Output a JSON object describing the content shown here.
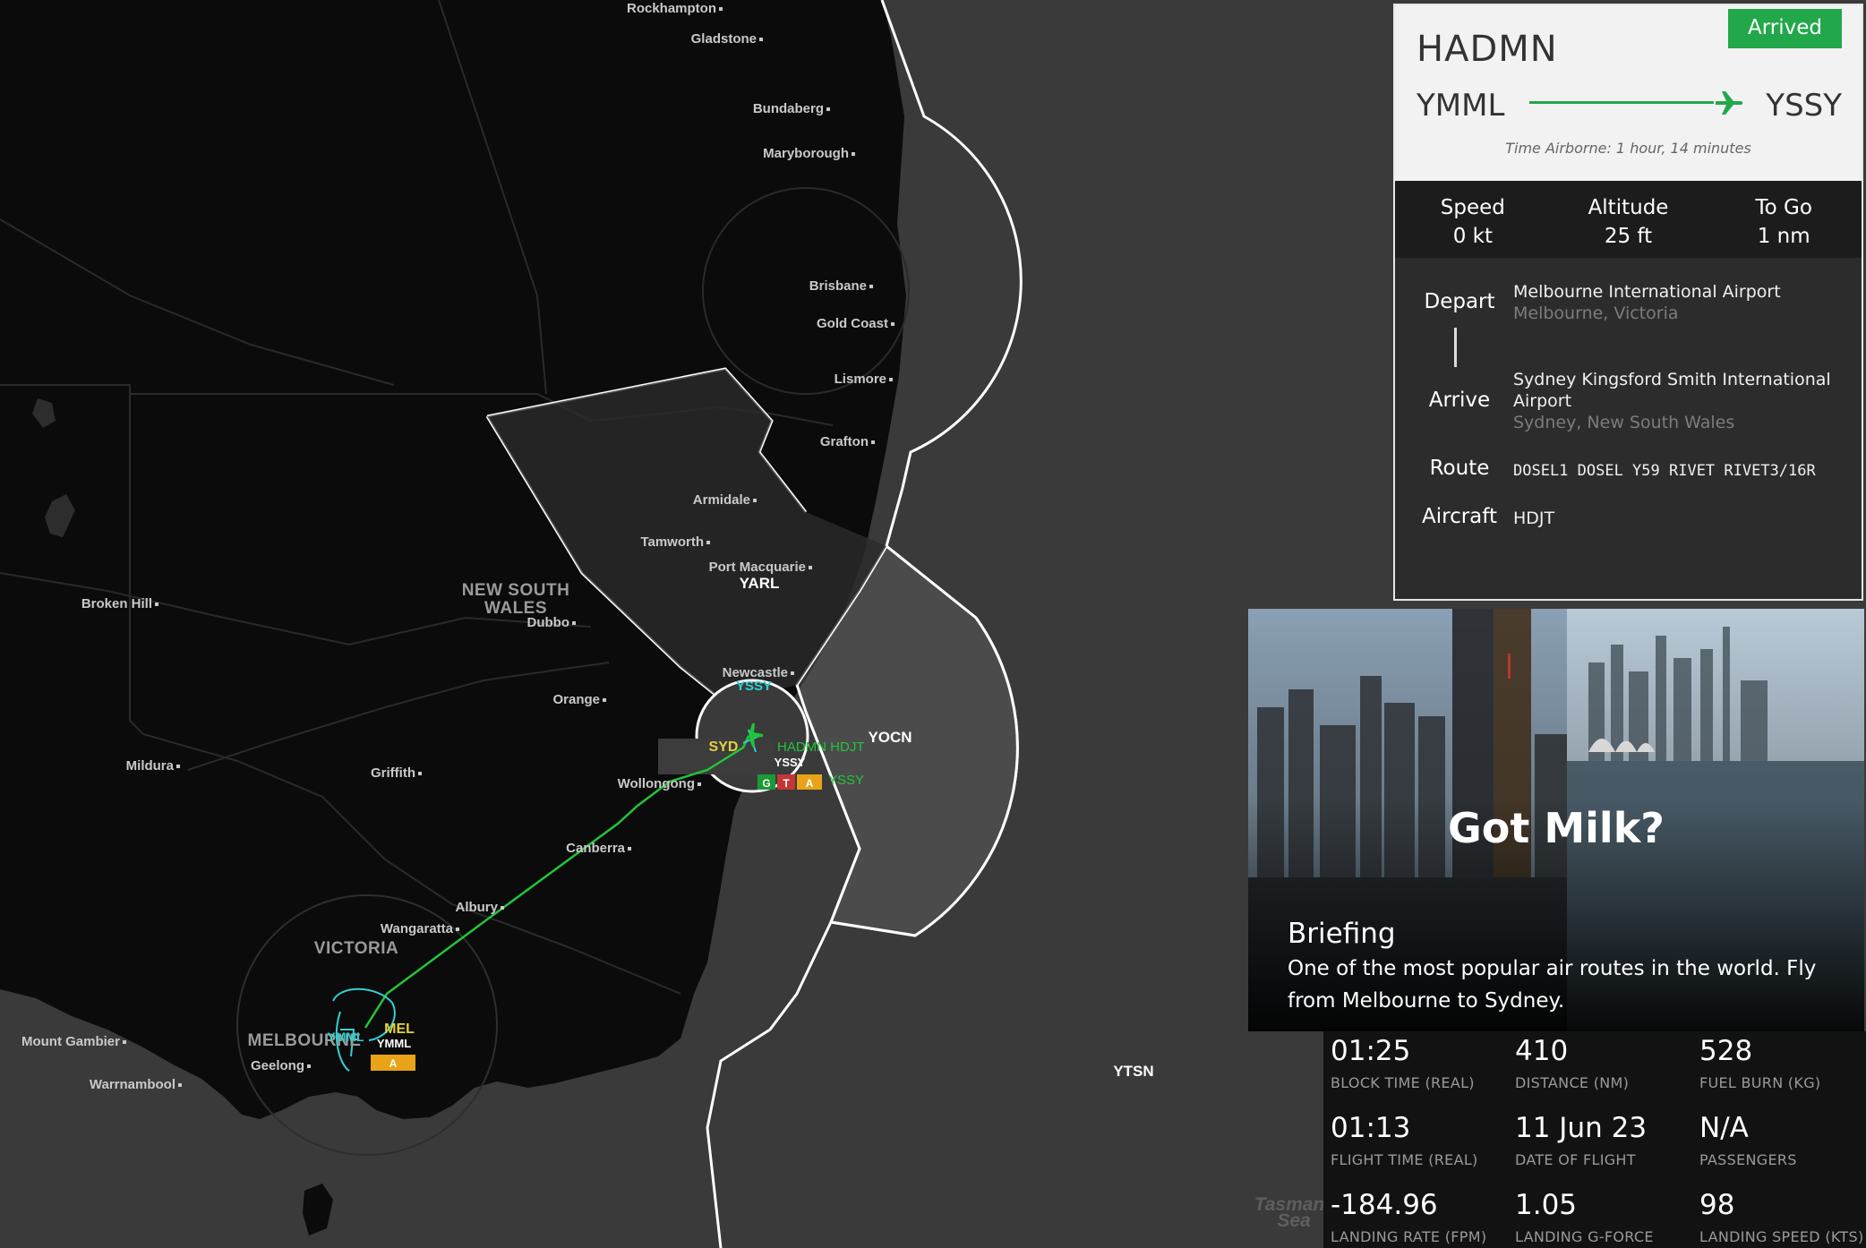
{
  "map": {
    "cities": [
      {
        "name": "Rockhampton"
      },
      {
        "name": "Gladstone"
      },
      {
        "name": "Bundaberg"
      },
      {
        "name": "Maryborough"
      },
      {
        "name": "Brisbane"
      },
      {
        "name": "Gold Coast"
      },
      {
        "name": "Lismore"
      },
      {
        "name": "Grafton"
      },
      {
        "name": "Armidale"
      },
      {
        "name": "Tamworth"
      },
      {
        "name": "Port Macquarie"
      },
      {
        "name": "Broken Hill"
      },
      {
        "name": "Dubbo"
      },
      {
        "name": "Newcastle"
      },
      {
        "name": "Orange"
      },
      {
        "name": "Mildura"
      },
      {
        "name": "Griffith"
      },
      {
        "name": "Wollongong"
      },
      {
        "name": "Canberra"
      },
      {
        "name": "Albury"
      },
      {
        "name": "Wangaratta"
      },
      {
        "name": "Mount Gambier"
      },
      {
        "name": "Geelong"
      },
      {
        "name": "Warrnambool"
      }
    ],
    "regions": [
      "NEW SOUTH",
      "WALES",
      "VICTORIA",
      "MELBOURNE"
    ],
    "sectors": [
      "YARL",
      "YOCN",
      "YTSN"
    ],
    "ocean": [
      "Tasman",
      "Sea"
    ],
    "airports": {
      "origin_code": "YMML",
      "origin_short": "MEL",
      "origin_alt": "YMML",
      "dest_code": "YSSY",
      "dest_short": "SYD",
      "dest_alt": "YSSY"
    },
    "aircraft_label": "HADMN HDJT",
    "dest_tag": "YSSY",
    "runway_badges": [
      "G",
      "T",
      "A"
    ],
    "origin_badge": "A",
    "route_color": "#22c43a"
  },
  "flight": {
    "callsign": "HADMN",
    "status": "Arrived",
    "origin": "YMML",
    "destination": "YSSY",
    "time_airborne": "Time Airborne: 1 hour, 14 minutes",
    "stats": [
      {
        "label": "Speed",
        "value": "0 kt"
      },
      {
        "label": "Altitude",
        "value": "25 ft"
      },
      {
        "label": "To Go",
        "value": "1 nm"
      }
    ],
    "depart_label": "Depart",
    "depart_name": "Melbourne International Airport",
    "depart_city": "Melbourne, Victoria",
    "arrive_label": "Arrive",
    "arrive_name": "Sydney Kingsford Smith International Airport",
    "arrive_city": "Sydney, New South Wales",
    "route_label": "Route",
    "route": "DOSEL1 DOSEL Y59 RIVET RIVET3/16R",
    "aircraft_label": "Aircraft",
    "aircraft": "HDJT"
  },
  "briefing": {
    "title": "Got Milk?",
    "heading": "Briefing",
    "text": "One of the most popular air routes in the world. Fly from Melbourne to Sydney."
  },
  "summary": [
    {
      "value": "01:25",
      "label": "BLOCK TIME (REAL)"
    },
    {
      "value": "410",
      "label": "DISTANCE (NM)"
    },
    {
      "value": "528",
      "label": "FUEL BURN (KG)"
    },
    {
      "value": "01:13",
      "label": "FLIGHT TIME (REAL)"
    },
    {
      "value": "11 Jun 23",
      "label": "DATE OF FLIGHT"
    },
    {
      "value": "N/A",
      "label": "PASSENGERS"
    },
    {
      "value": "-184.96",
      "label": "LANDING RATE (FPM)"
    },
    {
      "value": "1.05",
      "label": "LANDING G-FORCE"
    },
    {
      "value": "98",
      "label": "LANDING SPEED (KTS)"
    }
  ]
}
